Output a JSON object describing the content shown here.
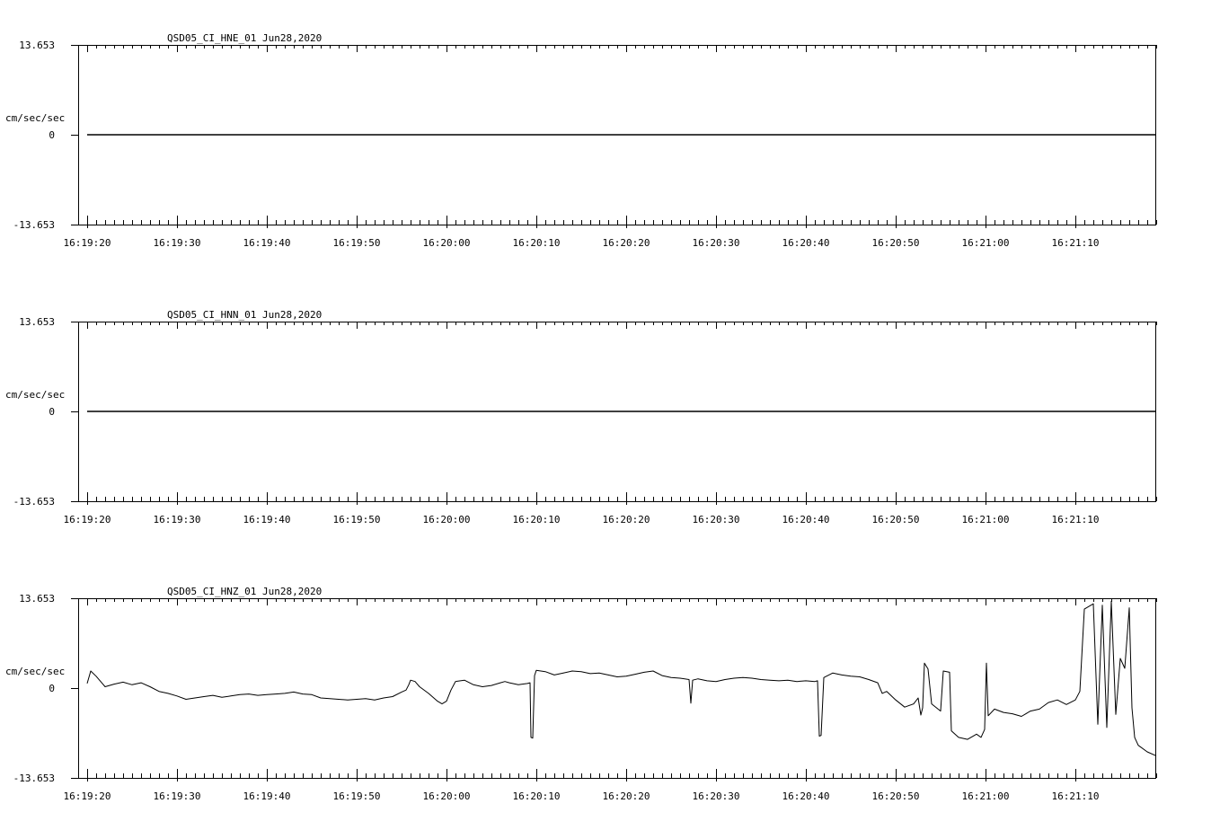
{
  "chart_data": [
    {
      "type": "line",
      "title": "QSD05_CI_HNE_01  Jun28,2020",
      "ylabel": "cm/sec/sec",
      "ylim": [
        -13.653,
        13.653
      ],
      "y_ticks": [
        "13.653",
        "0",
        "-13.653"
      ],
      "x_ticks": [
        "16:19:20",
        "16:19:30",
        "16:19:40",
        "16:19:50",
        "16:20:00",
        "16:20:10",
        "16:20:20",
        "16:20:30",
        "16:20:40",
        "16:20:50",
        "16:21:00",
        "16:21:10"
      ],
      "x_range_seconds": [
        0,
        119
      ],
      "series": [
        {
          "points": [
            [
              0,
              0
            ],
            [
              119,
              0
            ]
          ]
        }
      ]
    },
    {
      "type": "line",
      "title": "QSD05_CI_HNN_01  Jun28,2020",
      "ylabel": "cm/sec/sec",
      "ylim": [
        -13.653,
        13.653
      ],
      "y_ticks": [
        "13.653",
        "0",
        "-13.653"
      ],
      "x_ticks": [
        "16:19:20",
        "16:19:30",
        "16:19:40",
        "16:19:50",
        "16:20:00",
        "16:20:10",
        "16:20:20",
        "16:20:30",
        "16:20:40",
        "16:20:50",
        "16:21:00",
        "16:21:10"
      ],
      "x_range_seconds": [
        0,
        119
      ],
      "series": [
        {
          "points": [
            [
              0,
              0
            ],
            [
              119,
              0
            ]
          ]
        }
      ]
    },
    {
      "type": "line",
      "title": "QSD05_CI_HNZ_01  Jun28,2020",
      "ylabel": "cm/sec/sec",
      "ylim": [
        -13.653,
        13.653
      ],
      "y_ticks": [
        "13.653",
        "0",
        "-13.653"
      ],
      "x_ticks": [
        "16:19:20",
        "16:19:30",
        "16:19:40",
        "16:19:50",
        "16:20:00",
        "16:20:10",
        "16:20:20",
        "16:20:30",
        "16:20:40",
        "16:20:50",
        "16:21:00",
        "16:21:10"
      ],
      "x_range_seconds": [
        0,
        119
      ],
      "series": [
        {
          "points": [
            [
              0,
              0.7
            ],
            [
              0.4,
              2.6
            ],
            [
              1,
              1.8
            ],
            [
              2,
              0.2
            ],
            [
              3,
              0.6
            ],
            [
              4,
              0.9
            ],
            [
              5,
              0.5
            ],
            [
              6,
              0.8
            ],
            [
              7,
              0.2
            ],
            [
              8,
              -0.5
            ],
            [
              9,
              -0.8
            ],
            [
              10,
              -1.2
            ],
            [
              11,
              -1.7
            ],
            [
              12,
              -1.5
            ],
            [
              13,
              -1.3
            ],
            [
              14,
              -1.1
            ],
            [
              15,
              -1.4
            ],
            [
              16,
              -1.2
            ],
            [
              17,
              -1.0
            ],
            [
              18,
              -0.9
            ],
            [
              19,
              -1.1
            ],
            [
              20,
              -1.0
            ],
            [
              21,
              -0.9
            ],
            [
              22,
              -0.8
            ],
            [
              23,
              -0.6
            ],
            [
              24,
              -0.9
            ],
            [
              25,
              -1.0
            ],
            [
              26,
              -1.5
            ],
            [
              27,
              -1.6
            ],
            [
              28,
              -1.7
            ],
            [
              29,
              -1.8
            ],
            [
              30,
              -1.7
            ],
            [
              31,
              -1.6
            ],
            [
              32,
              -1.8
            ],
            [
              33,
              -1.5
            ],
            [
              34,
              -1.3
            ],
            [
              35,
              -0.6
            ],
            [
              35.5,
              -0.3
            ],
            [
              35.8,
              0.5
            ],
            [
              36,
              1.2
            ],
            [
              36.5,
              1.0
            ],
            [
              37,
              0.2
            ],
            [
              38,
              -0.8
            ],
            [
              39,
              -2.0
            ],
            [
              39.5,
              -2.4
            ],
            [
              40,
              -2.0
            ],
            [
              40.5,
              -0.3
            ],
            [
              41,
              1.0
            ],
            [
              42,
              1.2
            ],
            [
              43,
              0.5
            ],
            [
              44,
              0.2
            ],
            [
              45,
              0.4
            ],
            [
              46,
              0.8
            ],
            [
              46.5,
              1.0
            ],
            [
              47,
              0.8
            ],
            [
              48,
              0.5
            ],
            [
              49,
              0.7
            ],
            [
              49.3,
              0.8
            ],
            [
              49.4,
              -7.5
            ],
            [
              49.6,
              -7.6
            ],
            [
              49.8,
              1.9
            ],
            [
              50,
              2.7
            ],
            [
              51,
              2.5
            ],
            [
              52,
              2.0
            ],
            [
              53,
              2.3
            ],
            [
              54,
              2.6
            ],
            [
              55,
              2.5
            ],
            [
              56,
              2.2
            ],
            [
              57,
              2.3
            ],
            [
              58,
              2.0
            ],
            [
              59,
              1.7
            ],
            [
              60,
              1.8
            ],
            [
              61,
              2.1
            ],
            [
              62,
              2.4
            ],
            [
              63,
              2.6
            ],
            [
              64,
              1.9
            ],
            [
              65,
              1.6
            ],
            [
              66,
              1.5
            ],
            [
              67,
              1.3
            ],
            [
              67.2,
              -2.3
            ],
            [
              67.4,
              1.2
            ],
            [
              68,
              1.4
            ],
            [
              69,
              1.1
            ],
            [
              70,
              1.0
            ],
            [
              71,
              1.3
            ],
            [
              72,
              1.5
            ],
            [
              73,
              1.6
            ],
            [
              74,
              1.5
            ],
            [
              75,
              1.3
            ],
            [
              76,
              1.2
            ],
            [
              77,
              1.1
            ],
            [
              78,
              1.2
            ],
            [
              79,
              1.0
            ],
            [
              80,
              1.1
            ],
            [
              81,
              1.0
            ],
            [
              81.3,
              1.1
            ],
            [
              81.5,
              -7.3
            ],
            [
              81.7,
              -7.2
            ],
            [
              82,
              1.6
            ],
            [
              83,
              2.3
            ],
            [
              84,
              2.0
            ],
            [
              85,
              1.8
            ],
            [
              86,
              1.7
            ],
            [
              87,
              1.3
            ],
            [
              88,
              0.8
            ],
            [
              88.5,
              -0.8
            ],
            [
              89,
              -0.5
            ],
            [
              90,
              -1.8
            ],
            [
              91,
              -2.9
            ],
            [
              92,
              -2.4
            ],
            [
              92.5,
              -1.5
            ],
            [
              92.8,
              -4.1
            ],
            [
              93,
              -3.0
            ],
            [
              93.2,
              3.8
            ],
            [
              93.6,
              2.9
            ],
            [
              94,
              -2.4
            ],
            [
              95,
              -3.5
            ],
            [
              95.3,
              2.6
            ],
            [
              96,
              2.4
            ],
            [
              96.2,
              -6.5
            ],
            [
              97,
              -7.5
            ],
            [
              98,
              -7.8
            ],
            [
              99,
              -7.0
            ],
            [
              99.5,
              -7.5
            ],
            [
              99.9,
              -6.3
            ],
            [
              100.1,
              3.8
            ],
            [
              100.3,
              -4.2
            ],
            [
              101,
              -3.2
            ],
            [
              102,
              -3.7
            ],
            [
              103,
              -3.9
            ],
            [
              104,
              -4.3
            ],
            [
              105,
              -3.5
            ],
            [
              106,
              -3.2
            ],
            [
              107,
              -2.2
            ],
            [
              108,
              -1.8
            ],
            [
              109,
              -2.5
            ],
            [
              110,
              -1.8
            ],
            [
              110.5,
              -0.5
            ],
            [
              111,
              12.0
            ],
            [
              112,
              12.8
            ],
            [
              112.5,
              -5.5
            ],
            [
              113,
              12.6
            ],
            [
              113.5,
              -6.0
            ],
            [
              114,
              13.2
            ],
            [
              114.5,
              -4.0
            ],
            [
              115,
              4.5
            ],
            [
              115.5,
              3.0
            ],
            [
              116,
              12.2
            ],
            [
              116.3,
              -3.0
            ],
            [
              116.6,
              -7.5
            ],
            [
              117,
              -8.7
            ],
            [
              118,
              -9.7
            ],
            [
              119,
              -10.3
            ]
          ]
        }
      ]
    }
  ]
}
